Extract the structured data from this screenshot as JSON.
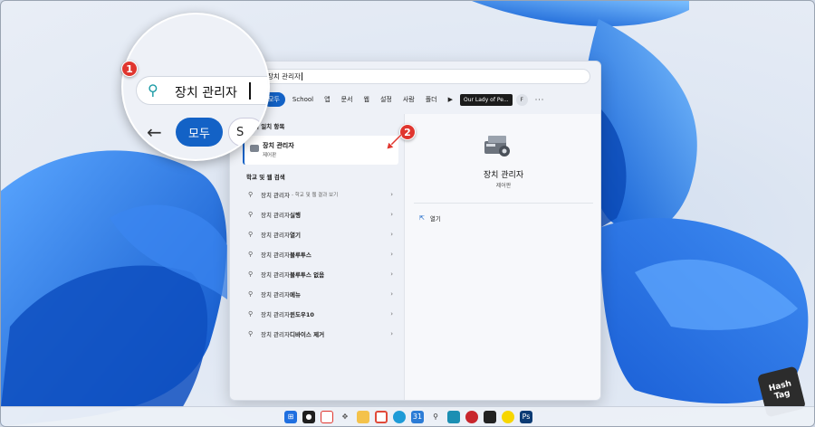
{
  "search": {
    "query": "장치 관리자"
  },
  "filters": [
    "모두",
    "School",
    "앱",
    "문서",
    "웹",
    "설정",
    "사람",
    "폴더"
  ],
  "filter_extra": {
    "play": "▶",
    "org": "Our Lady of Pe...",
    "avatar": "F",
    "more": "···"
  },
  "best_match": {
    "header": "최고의 일치 항목",
    "title": "장치 관리자",
    "subtitle": "제어판"
  },
  "web_header": "학교 및 웹 검색",
  "web_items": [
    {
      "prefix": "장치 관리자",
      "bold": "",
      "hint": "- 학교 및 웹 결과 보기"
    },
    {
      "prefix": "장치 관리자 ",
      "bold": "실행",
      "hint": ""
    },
    {
      "prefix": "장치 관리자 ",
      "bold": "열기",
      "hint": ""
    },
    {
      "prefix": "장치 관리자 ",
      "bold": "블루투스",
      "hint": ""
    },
    {
      "prefix": "장치 관리자 ",
      "bold": "블루투스 없음",
      "hint": ""
    },
    {
      "prefix": "장치 관리자 ",
      "bold": "메뉴",
      "hint": ""
    },
    {
      "prefix": "장치 관리자 ",
      "bold": "윈도우10",
      "hint": ""
    },
    {
      "prefix": "장치 관리자 ",
      "bold": "디바이스 제거",
      "hint": ""
    }
  ],
  "detail": {
    "title": "장치 관리자",
    "subtitle": "제어판",
    "open_label": "열기"
  },
  "magnifier": {
    "query": "장치 관리자",
    "all_label": "모두",
    "next_chip": "S"
  },
  "badges": [
    "1",
    "2"
  ],
  "logo": {
    "line1": "Hash",
    "line2": "Tag"
  },
  "colors": {
    "accent": "#1362c6",
    "badge": "#e0362f",
    "wallpaper": "#1f6fe0"
  },
  "taskbar_icons": [
    "windows-icon",
    "media-icon",
    "snip-icon",
    "move-icon",
    "folder-icon",
    "chrome-icon",
    "edge-icon",
    "calendar-icon",
    "search-icon",
    "monitor-icon",
    "red-app-icon",
    "sticky-notes-icon",
    "kakaotalk-icon",
    "photoshop-icon"
  ]
}
